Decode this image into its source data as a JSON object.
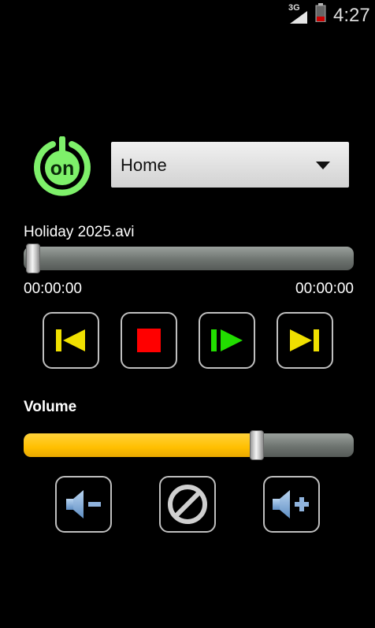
{
  "status_bar": {
    "network": "3G",
    "time": "4:27"
  },
  "power": {
    "label": "on",
    "color": "#7ef06a"
  },
  "profile": {
    "selected": "Home"
  },
  "player": {
    "file_name": "Holiday 2025.avi",
    "elapsed": "00:00:00",
    "duration": "00:00:00",
    "progress": 0
  },
  "transport": [
    {
      "name": "previous-icon",
      "color": "#f0e000"
    },
    {
      "name": "stop-icon",
      "color": "#ff0000"
    },
    {
      "name": "play-icon",
      "color": "#22dd00"
    },
    {
      "name": "next-icon",
      "color": "#f0e000"
    }
  ],
  "volume": {
    "label": "Volume",
    "level": 0.69,
    "accent": "#ffbf00",
    "buttons": [
      "volume-down-icon",
      "mute-icon",
      "volume-up-icon"
    ]
  }
}
